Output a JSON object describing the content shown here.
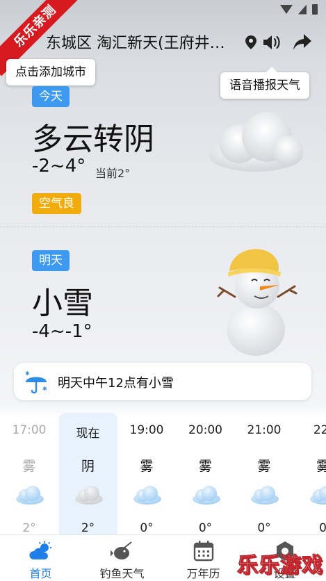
{
  "ribbon_text": "乐乐亲测",
  "header": {
    "title": "东城区 淘汇新天(王府井…"
  },
  "tips": {
    "add_city": "点击添加城市",
    "voice": "语音播报天气"
  },
  "today": {
    "tag": "今天",
    "condition": "多云转阴",
    "temp_range": "-2~4°",
    "current": "当前2°",
    "aqi": "空气良"
  },
  "tomorrow": {
    "tag": "明天",
    "condition": "小雪",
    "temp_range": "-4~-1°"
  },
  "alert": {
    "text": "明天中午12点有小雪"
  },
  "hourly": [
    {
      "time": "17:00",
      "cond": "雾",
      "temp": "2°",
      "icon": "cloud-blue-icon"
    },
    {
      "time": "现在",
      "cond": "阴",
      "temp": "2°",
      "icon": "cloud-gray-icon"
    },
    {
      "time": "19:00",
      "cond": "雾",
      "temp": "0°",
      "icon": "cloud-blue-icon"
    },
    {
      "time": "20:00",
      "cond": "雾",
      "temp": "0°",
      "icon": "cloud-blue-icon"
    },
    {
      "time": "21:00",
      "cond": "雾",
      "temp": "0°",
      "icon": "cloud-blue-icon"
    },
    {
      "time": "22:",
      "cond": "雾",
      "temp": "0",
      "icon": "cloud-blue-icon"
    }
  ],
  "nav": [
    {
      "label": "首页",
      "icon": "home-weather-icon"
    },
    {
      "label": "钓鱼天气",
      "icon": "fish-icon"
    },
    {
      "label": "万年历",
      "icon": "calendar-icon"
    },
    {
      "label": "设置",
      "icon": "settings-icon"
    }
  ],
  "watermark": "乐乐游戏",
  "colors": {
    "accent": "#1f7ee8",
    "tag_blue": "#3e9af0",
    "tag_yellow": "#f2ab0c",
    "ribbon": "#d71920"
  }
}
